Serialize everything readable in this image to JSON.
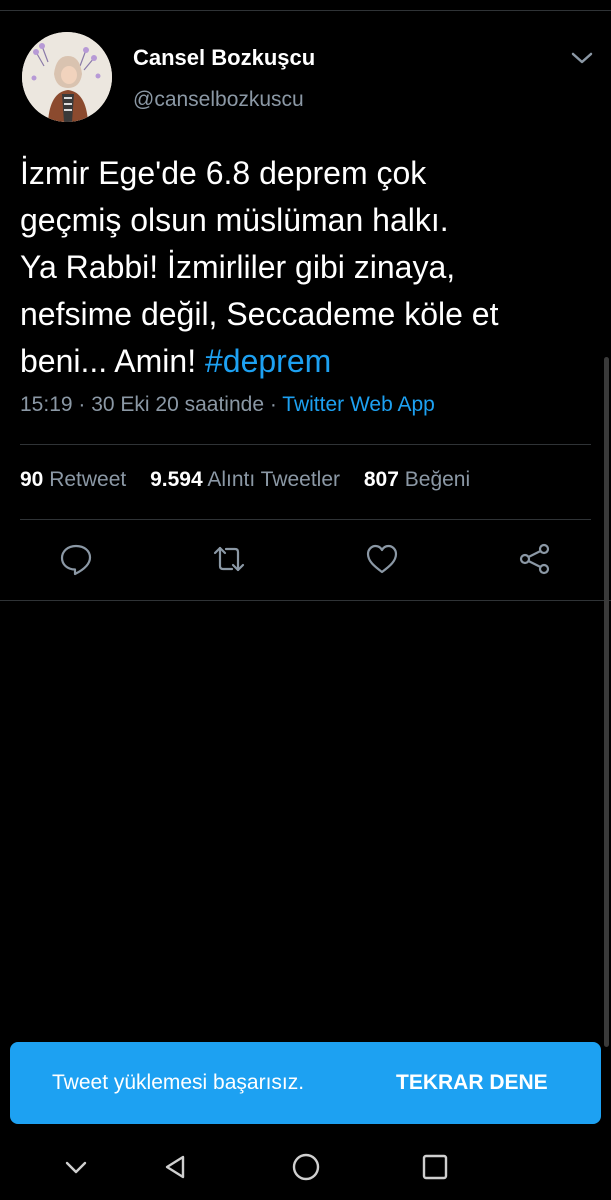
{
  "tweet": {
    "author": {
      "display_name": "Cansel Bozkuşcu",
      "handle": "@canselbozkuscu"
    },
    "text_lines": [
      "İzmir Ege'de 6.8  deprem çok",
      "geçmiş olsun müslüman halkı.",
      "Ya Rabbi! İzmirliler gibi zinaya,",
      "nefsime değil, Seccademe köle et",
      "beni... Amin! "
    ],
    "hashtag": "#deprem",
    "meta": {
      "timestamp": "15:19 · 30 Eki 20 saatinde · ",
      "source": "Twitter Web App"
    },
    "stats": {
      "retweets_count": "90",
      "retweets_label": "Retweet",
      "quotes_count": "9.594",
      "quotes_label": "Alıntı Tweetler",
      "likes_count": "807",
      "likes_label": "Beğeni"
    },
    "actions": [
      "reply-icon",
      "retweet-icon",
      "like-icon",
      "share-icon"
    ]
  },
  "snackbar": {
    "message": "Tweet yüklemesi başarısız.",
    "action_label": "TEKRAR DENE"
  },
  "colors": {
    "background": "#000000",
    "accent": "#1da1f2",
    "secondary_text": "#8b98a5",
    "divider": "#2f3336"
  }
}
